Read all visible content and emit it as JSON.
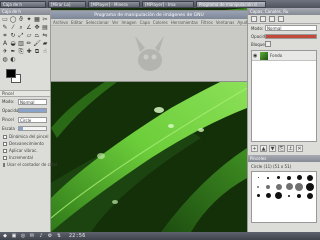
{
  "taskbar": {
    "tasks": [
      {
        "label": "Caja de h",
        "active": false
      },
      {
        "label": "[Mirar La]",
        "active": false
      },
      {
        "label": "[MPlayer] - Minera",
        "active": false
      },
      {
        "label": "[MPlayer] - Ima",
        "active": false
      },
      {
        "label": "Programa de manipulación d",
        "active": true
      }
    ]
  },
  "image_window": {
    "title": "Programa de manipulación de imágenes de GNU",
    "menu": [
      "Archivo",
      "Editar",
      "Seleccionar",
      "Ver",
      "Imagen",
      "Capa",
      "Colores",
      "Herramientas",
      "Filtros",
      "Ventanas",
      "Ayuda"
    ]
  },
  "toolbox": {
    "title": "Caja de h",
    "tools": [
      "rect-select-icon",
      "ellipse-select-icon",
      "free-select-icon",
      "fuzzy-select-icon",
      "color-select-icon",
      "scissors-icon",
      "paths-icon",
      "color-picker-icon",
      "zoom-icon",
      "measure-icon",
      "move-icon",
      "align-icon",
      "crop-icon",
      "rotate-icon",
      "scale-icon",
      "shear-icon",
      "perspective-icon",
      "flip-icon",
      "text-icon",
      "bucket-fill-icon",
      "blend-icon",
      "pencil-icon",
      "paintbrush-icon",
      "eraser-icon",
      "airbrush-icon",
      "ink-icon",
      "clone-icon",
      "heal-icon",
      "perspective-clone-icon",
      "smudge-icon",
      "blur-icon",
      "dodge-burn-icon"
    ],
    "options_tab": "Pincel",
    "mode_label": "Modo:",
    "mode_value": "Normal",
    "opacity_label": "Opacidad",
    "opacity_value": 1.0,
    "brush_label": "Pincel",
    "brush_value": "Circle",
    "scale_label": "Escala",
    "checkboxes": [
      "Dinámica del pincel",
      "Desvanecimiento",
      "Aplicar vibrac.",
      "Incremental",
      "Usar el contador de color"
    ]
  },
  "dock": {
    "title": "Capas, Canales, Ru",
    "mode_label": "Modo:",
    "mode_value": "Normal",
    "opacity_label": "Opacidad",
    "opacity_value": 1.0,
    "lock_label": "Bloquear:",
    "layer_name": "Fondo",
    "brushes_title": "Pinceles",
    "brush_info": "Circle (11) (51 x 51)"
  },
  "bottombar": {
    "clock": "22:56",
    "icons": [
      "menu-icon",
      "terminal-icon",
      "browser-icon",
      "mail-icon",
      "music-icon",
      "settings-icon",
      "network-icon"
    ]
  },
  "colors": {
    "fg": "#000000",
    "bg": "#ffffff",
    "leaf": "#3d8f20"
  }
}
